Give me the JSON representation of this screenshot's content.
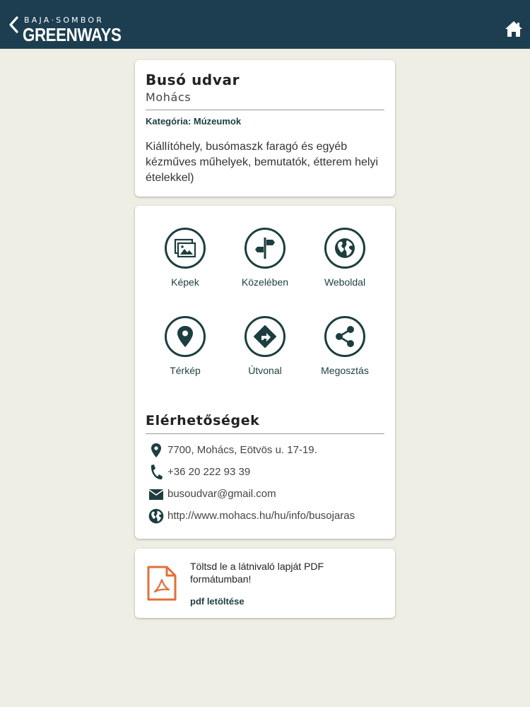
{
  "header": {
    "logo_top": "BAJA·SOMBOR",
    "logo_main": "GREENWAYS",
    "colors": {
      "bar": "#1c3e50",
      "text": "#ffffff"
    }
  },
  "poi": {
    "title": "Busó udvar",
    "city": "Mohács",
    "category": "Kategória: Múzeumok",
    "description": "Kiállítóhely, busómaszk faragó és egyéb kézműves műhelyek, bemutatók, étterem helyi ételekkel)"
  },
  "actions": [
    {
      "label": "Képek",
      "icon": "images-icon"
    },
    {
      "label": "Közelében",
      "icon": "signpost-icon"
    },
    {
      "label": "Weboldal",
      "icon": "globe-icon"
    },
    {
      "label": "Térkép",
      "icon": "map-pin-icon"
    },
    {
      "label": "Útvonal",
      "icon": "directions-icon"
    },
    {
      "label": "Megosztás",
      "icon": "share-icon"
    }
  ],
  "contacts": {
    "title": "Elérhetőségek",
    "address": "7700, Mohács, Eötvös u. 17-19.",
    "phone": "+36 20 222 93 39",
    "email": "busoudvar@gmail.com",
    "website": "http://www.mohacs.hu/hu/info/busojaras"
  },
  "pdf": {
    "text": "Töltsd le a látnivaló lapját PDF formátumban!",
    "link": "pdf letöltése"
  },
  "colors": {
    "accent": "#1c3e40",
    "pdf": "#e0703a",
    "background": "#eeeee4"
  }
}
